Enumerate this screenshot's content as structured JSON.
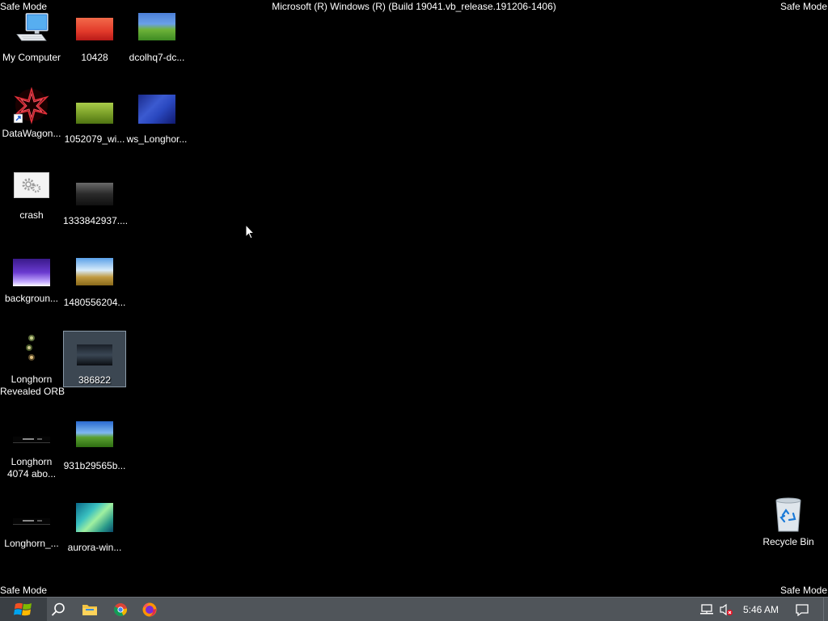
{
  "safe_mode": {
    "top_left": "Safe Mode",
    "top_right": "Safe Mode",
    "bottom_left": "Safe Mode",
    "bottom_right": "Safe Mode"
  },
  "build_title": "Microsoft (R) Windows (R) (Build 19041.vb_release.191206-1406)",
  "desktop_icons": [
    {
      "label": "My Computer",
      "icon": "computer-icon"
    },
    {
      "label": "10428",
      "icon": "image-thumbnail-icon"
    },
    {
      "label": "dcolhq7-dc...",
      "icon": "image-thumbnail-icon"
    },
    {
      "label": "DataWagon...",
      "icon": "shortcut-icon"
    },
    {
      "label": "1052079_wi...",
      "icon": "image-thumbnail-icon"
    },
    {
      "label": "ws_Longhor...",
      "icon": "image-thumbnail-icon"
    },
    {
      "label": "crash",
      "icon": "gear-icon"
    },
    {
      "label": "1333842937....",
      "icon": "image-thumbnail-icon"
    },
    {
      "label": "backgroun...",
      "icon": "image-thumbnail-icon"
    },
    {
      "label": "1480556204...",
      "icon": "image-thumbnail-icon"
    },
    {
      "label": "Longhorn",
      "label2": "Revealed ORB",
      "icon": "orb-icon"
    },
    {
      "label": "386822",
      "icon": "image-thumbnail-icon",
      "selected": true
    },
    {
      "label": "Longhorn",
      "label2": "4074 abo...",
      "icon": "image-thumbnail-icon"
    },
    {
      "label": "931b29565b...",
      "icon": "image-thumbnail-icon"
    },
    {
      "label": "Longhorn_...",
      "icon": "image-thumbnail-icon"
    },
    {
      "label": "aurora-win...",
      "icon": "image-thumbnail-icon"
    },
    {
      "label": "Recycle Bin",
      "icon": "recycle-bin-icon"
    }
  ],
  "taskbar": {
    "start": "windows-start-icon",
    "search": "search-icon",
    "pinned": [
      "file-explorer-icon",
      "chrome-icon",
      "firefox-icon"
    ],
    "clock": "5:46 AM",
    "tray_icons": [
      "network-icon",
      "volume-muted-icon",
      "action-center-icon"
    ],
    "bg_color": "#50555a"
  }
}
